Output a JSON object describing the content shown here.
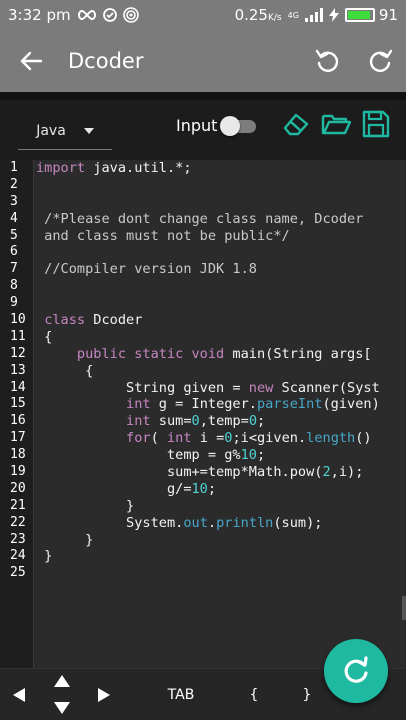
{
  "status": {
    "time": "3:32 pm",
    "speed": "0.25",
    "speed_unit": "K/s",
    "network": "4G",
    "battery": "91",
    "battery_level": 0.91
  },
  "appbar": {
    "title": "Dcoder"
  },
  "toolbar": {
    "language": "Java",
    "input_label": "Input",
    "input_enabled": false
  },
  "editor": {
    "line_numbers": [
      "1",
      "2",
      "3",
      "4",
      "5",
      "6",
      "7",
      "8",
      "9",
      "10",
      "11",
      "12",
      "13",
      "14",
      "15",
      "16",
      "17",
      "18",
      "19",
      "20",
      "21",
      "22",
      "23",
      "24",
      "25"
    ]
  },
  "bottombar": {
    "tab_label": "TAB",
    "brace_open": "{",
    "brace_close": "}"
  },
  "colors": {
    "accent": "#1fb9a2",
    "appbar": "#7b7b7b",
    "keyword": "#c586c0",
    "number": "#4fd3d3",
    "method": "#46a6c8"
  }
}
